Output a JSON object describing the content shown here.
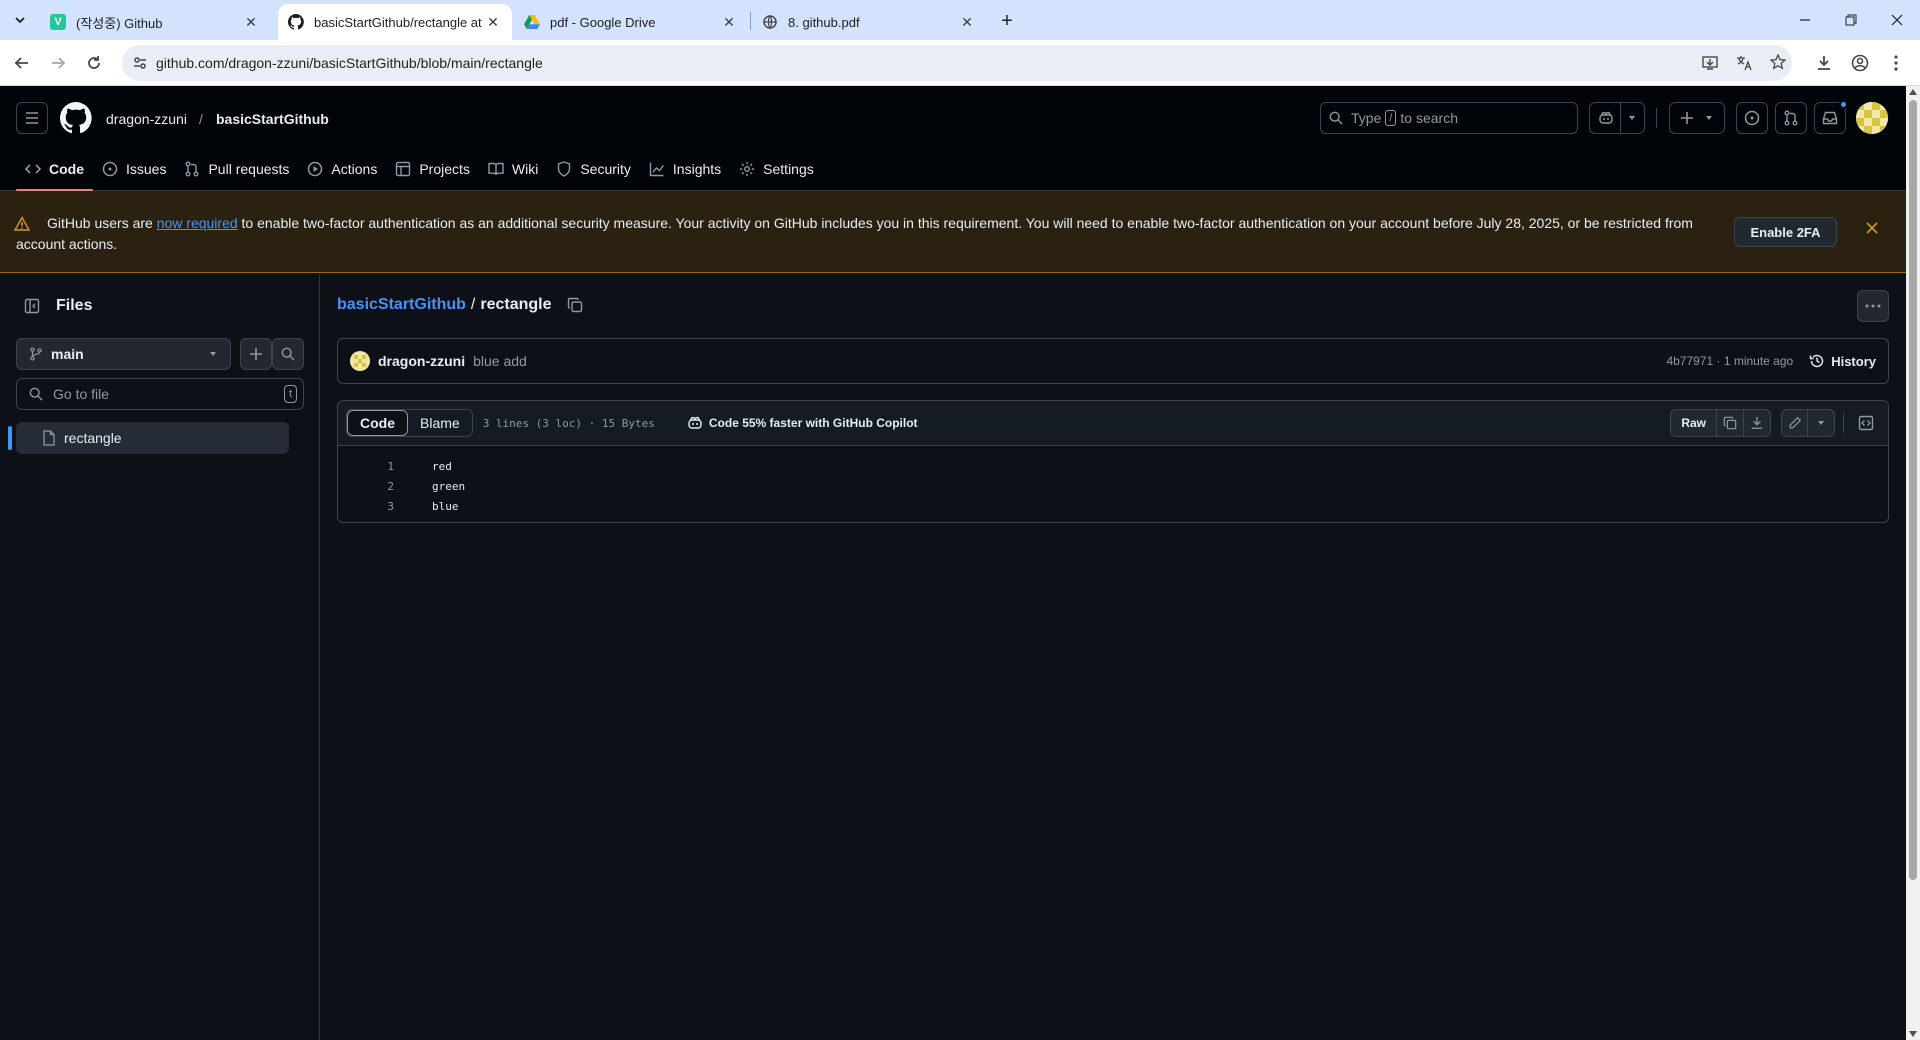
{
  "browser": {
    "tabs": [
      {
        "title": "(작성중) Github",
        "favicon": "v-icon",
        "active": false
      },
      {
        "title": "basicStartGithub/rectangle at m",
        "favicon": "github-icon",
        "active": true
      },
      {
        "title": "pdf - Google Drive",
        "favicon": "drive-icon",
        "active": false
      },
      {
        "title": "8. github.pdf",
        "favicon": "globe-icon",
        "active": false
      }
    ],
    "url": "github.com/dragon-zzuni/basicStartGithub/blob/main/rectangle"
  },
  "header": {
    "owner": "dragon-zzuni",
    "separator": "/",
    "repo": "basicStartGithub",
    "search_prefix": "Type",
    "search_key": "/",
    "search_suffix": "to search",
    "nav": [
      {
        "label": "Code",
        "icon": "code-icon",
        "selected": true
      },
      {
        "label": "Issues",
        "icon": "issue-icon"
      },
      {
        "label": "Pull requests",
        "icon": "pull-request-icon"
      },
      {
        "label": "Actions",
        "icon": "play-icon"
      },
      {
        "label": "Projects",
        "icon": "table-icon"
      },
      {
        "label": "Wiki",
        "icon": "book-icon"
      },
      {
        "label": "Security",
        "icon": "shield-icon"
      },
      {
        "label": "Insights",
        "icon": "graph-icon"
      },
      {
        "label": "Settings",
        "icon": "gear-icon"
      }
    ]
  },
  "banner": {
    "text_before": "GitHub users are ",
    "link": "now required",
    "text_after": " to enable two-factor authentication as an additional security measure. Your activity on GitHub includes you in this requirement. You will need to enable two-factor authentication on your account before July 28, 2025, or be restricted from account actions.",
    "button": "Enable 2FA"
  },
  "sidebar": {
    "title": "Files",
    "branch": "main",
    "goto_placeholder": "Go to file",
    "goto_key": "t",
    "files": [
      {
        "name": "rectangle"
      }
    ]
  },
  "main": {
    "path_repo": "basicStartGithub",
    "path_sep": "/",
    "path_file": "rectangle",
    "commit": {
      "author": "dragon-zzuni",
      "message": "blue add",
      "meta": "4b77971 · 1 minute ago",
      "history": "History"
    },
    "code": {
      "tab_code": "Code",
      "tab_blame": "Blame",
      "info": "3 lines (3 loc) · 15 Bytes",
      "copilot": "Code 55% faster with GitHub Copilot",
      "raw": "Raw",
      "lines": [
        {
          "n": "1",
          "text": "red"
        },
        {
          "n": "2",
          "text": "green"
        },
        {
          "n": "3",
          "text": "blue"
        }
      ]
    }
  },
  "colors": {
    "accent": "#f78166",
    "link": "#4493f8",
    "banner_bg": "#2b2111",
    "warning": "#d29922"
  }
}
